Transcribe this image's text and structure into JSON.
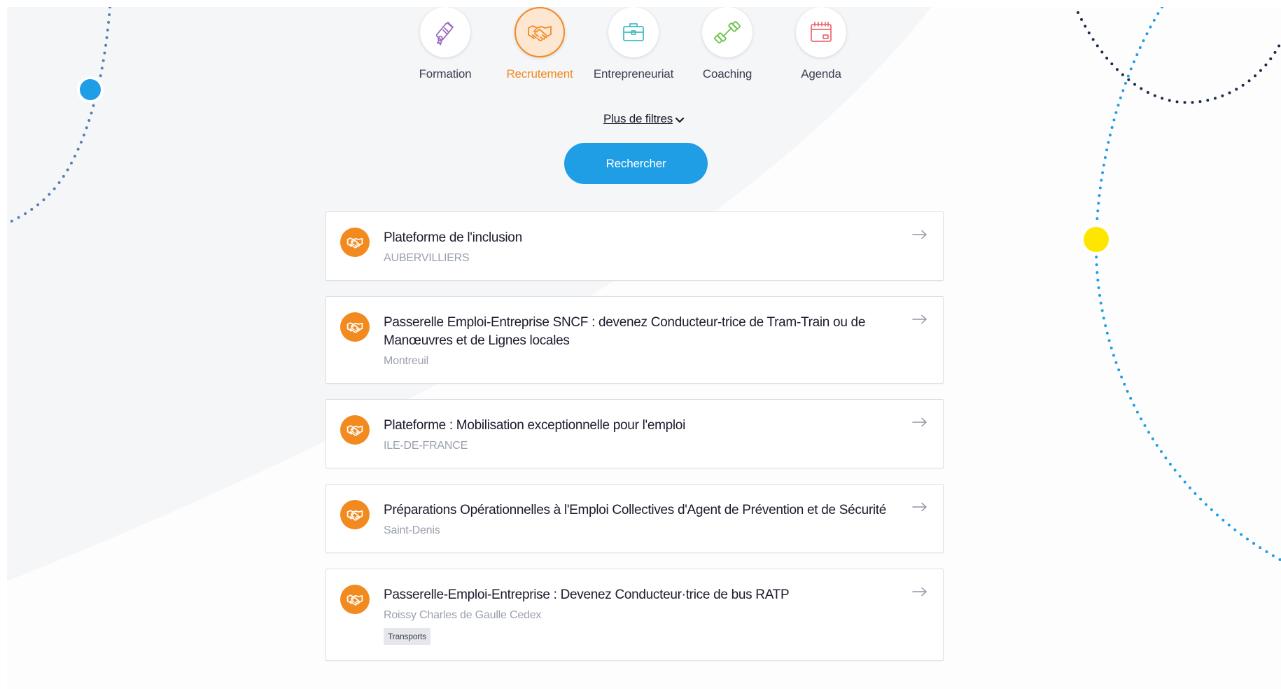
{
  "categories": [
    {
      "label": "Formation",
      "icon": "diploma-icon",
      "color": "#9b6cc2",
      "active": false
    },
    {
      "label": "Recrutement",
      "icon": "handshake-icon",
      "color": "#f28a1f",
      "active": true
    },
    {
      "label": "Entrepreneuriat",
      "icon": "briefcase-icon",
      "color": "#42bfc6",
      "active": false
    },
    {
      "label": "Coaching",
      "icon": "dumbbell-icon",
      "color": "#6cc24a",
      "active": false
    },
    {
      "label": "Agenda",
      "icon": "calendar-icon",
      "color": "#ef6b73",
      "active": false
    }
  ],
  "filters": {
    "more_label": "Plus de filtres",
    "more_icon": "chevron-down-icon"
  },
  "search": {
    "button_label": "Rechercher",
    "button_color": "#1f9ee6"
  },
  "results": [
    {
      "title": "Plateforme de l'inclusion",
      "location": "AUBERVILLIERS",
      "tag": "",
      "icon": "handshake-icon"
    },
    {
      "title": "Passerelle Emploi-Entreprise SNCF : devenez Conducteur-trice de Tram-Train ou de Manœuvres et de Lignes locales",
      "location": "Montreuil",
      "tag": "",
      "icon": "handshake-icon"
    },
    {
      "title": "Plateforme : Mobilisation exceptionnelle pour l'emploi",
      "location": "ILE-DE-FRANCE",
      "tag": "",
      "icon": "handshake-icon"
    },
    {
      "title": "Préparations Opérationnelles à l'Emploi Collectives d'Agent de Prévention et de Sécurité",
      "location": "Saint-Denis",
      "tag": "",
      "icon": "handshake-icon"
    },
    {
      "title": "Passerelle-Emploi-Entreprise : Devenez Conducteur·trice de bus RATP",
      "location": "Roissy Charles de Gaulle Cedex",
      "tag": "Transports",
      "icon": "handshake-icon"
    }
  ],
  "theme": {
    "accent_orange": "#f28a1f",
    "accent_blue": "#1f9ee6",
    "dot_yellow": "#ffe600",
    "dot_navy": "#1b2a4a"
  }
}
